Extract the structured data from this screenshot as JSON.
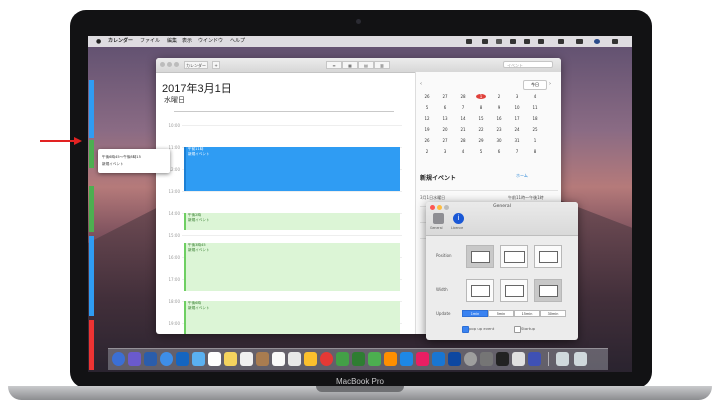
{
  "device": {
    "brand_label": "MacBook Pro"
  },
  "menubar": {
    "items": [
      "カレンダー",
      "ファイル",
      "編集",
      "表示",
      "ウインドウ",
      "ヘルプ"
    ]
  },
  "calendar": {
    "search_placeholder": "イベント",
    "toolbar_buttons": [
      "カレンダー"
    ],
    "date_title": "2017年3月1日",
    "weekday": "水曜日",
    "times": [
      "10:00",
      "11:00",
      "12:00",
      "13:00",
      "14:00",
      "15:00",
      "16:00",
      "17:00",
      "18:00",
      "19:00"
    ],
    "events": [
      {
        "time": "午前11時",
        "title": "新規イベント",
        "color": "blue"
      },
      {
        "time": "午後2時",
        "title": "新規イベント",
        "color": "green"
      },
      {
        "time": "午後3時45",
        "title": "新規イベント",
        "color": "green"
      },
      {
        "time": "午後6時",
        "title": "新規イベント",
        "color": "green"
      }
    ],
    "mini_month": {
      "today_button": "今日",
      "selected_day": "1",
      "rows": [
        [
          "26",
          "27",
          "28",
          "1",
          "2",
          "3",
          "4"
        ],
        [
          "5",
          "6",
          "7",
          "8",
          "9",
          "10",
          "11"
        ],
        [
          "12",
          "13",
          "14",
          "15",
          "16",
          "17",
          "18"
        ],
        [
          "19",
          "20",
          "21",
          "22",
          "23",
          "24",
          "25"
        ],
        [
          "26",
          "27",
          "28",
          "29",
          "30",
          "31",
          "1"
        ],
        [
          "2",
          "3",
          "4",
          "5",
          "6",
          "7",
          "8"
        ]
      ]
    },
    "detail": {
      "title": "新規イベント",
      "calendar_label": "ホーム",
      "date_line": "3月1日水曜日",
      "time_line": "午前11時〜午後1時"
    }
  },
  "popup": {
    "time_text": "午後6時45〜午後8時15",
    "title": "新規イベント"
  },
  "prefs": {
    "window_title": "General",
    "tabs": [
      "General",
      "Licence"
    ],
    "labels": {
      "position": "Position",
      "width": "Width",
      "update": "Update"
    },
    "update_options": [
      "1min",
      "5min",
      "15min",
      "30min"
    ],
    "update_selected": "1min",
    "checkboxes": [
      {
        "label": "pop up event",
        "checked": true
      },
      {
        "label": "Startup",
        "checked": false
      }
    ]
  },
  "colors": {
    "annotation_arrow": "#e22222",
    "event_blue": "#2f9cf3",
    "event_green": "#dcf5d6",
    "selected_day": "#e0403a",
    "segment_active": "#3a83f1"
  }
}
